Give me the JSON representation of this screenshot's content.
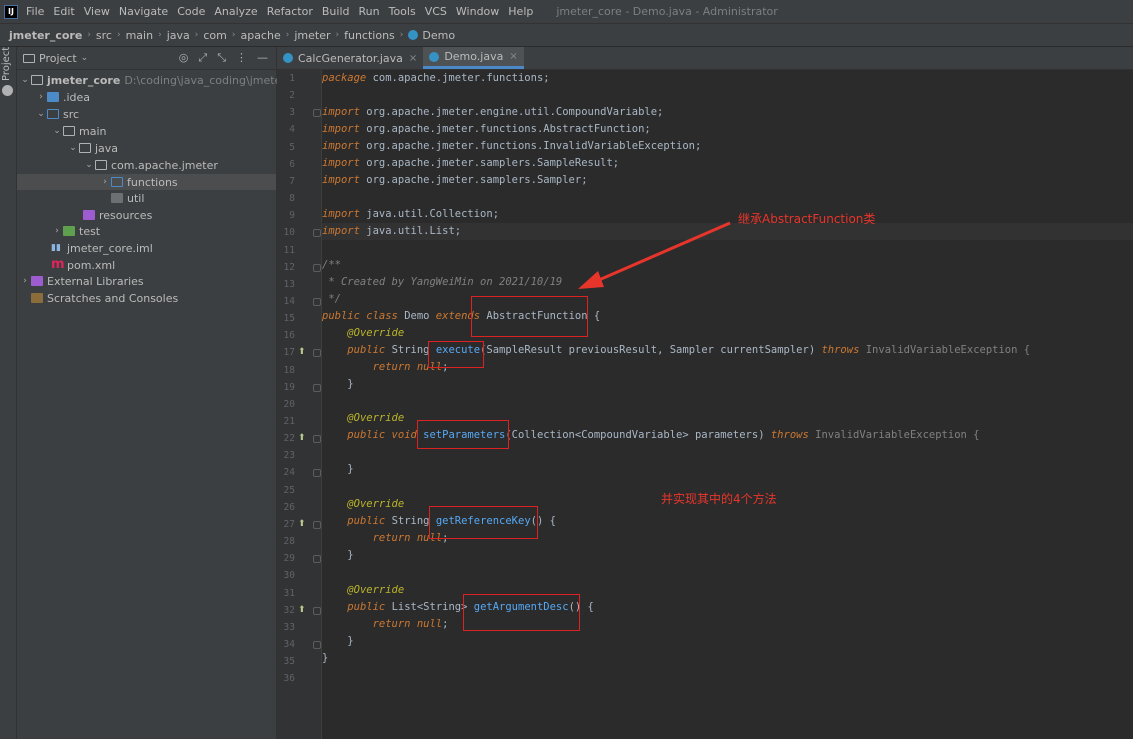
{
  "menu": {
    "items": [
      "File",
      "Edit",
      "View",
      "Navigate",
      "Code",
      "Analyze",
      "Refactor",
      "Build",
      "Run",
      "Tools",
      "VCS",
      "Window",
      "Help"
    ],
    "window_title": "jmeter_core - Demo.java - Administrator"
  },
  "breadcrumb": [
    "jmeter_core",
    "src",
    "main",
    "java",
    "com",
    "apache",
    "jmeter",
    "functions",
    "Demo"
  ],
  "project_panel": {
    "title": "Project",
    "stripe_label": "Project",
    "tree": [
      {
        "label": "jmeter_core",
        "path": "D:\\coding\\java_coding\\jmeter_core"
      },
      {
        "label": ".idea"
      },
      {
        "label": "src"
      },
      {
        "label": "main"
      },
      {
        "label": "java"
      },
      {
        "label": "com.apache.jmeter"
      },
      {
        "label": "functions"
      },
      {
        "label": "util"
      },
      {
        "label": "resources"
      },
      {
        "label": "test"
      },
      {
        "label": "jmeter_core.iml"
      },
      {
        "label": "pom.xml"
      },
      {
        "label": "External Libraries"
      },
      {
        "label": "Scratches and Consoles"
      }
    ]
  },
  "editor_tabs": [
    {
      "label": "CalcGenerator.java",
      "active": false
    },
    {
      "label": "Demo.java",
      "active": true
    }
  ],
  "line_numbers": [
    "1",
    "2",
    "3",
    "4",
    "5",
    "6",
    "7",
    "8",
    "9",
    "10",
    "11",
    "12",
    "13",
    "14",
    "15",
    "16",
    "17",
    "18",
    "19",
    "20",
    "21",
    "22",
    "23",
    "24",
    "25",
    "26",
    "27",
    "28",
    "29",
    "30",
    "31",
    "32",
    "33",
    "34",
    "35",
    "36"
  ],
  "code": {
    "package_stmt": "com.apache.jmeter.functions;",
    "imports": [
      "org.apache.jmeter.engine.util.CompoundVariable;",
      "org.apache.jmeter.functions.AbstractFunction;",
      "org.apache.jmeter.functions.InvalidVariableException;",
      "org.apache.jmeter.samplers.SampleResult;",
      "org.apache.jmeter.samplers.Sampler;",
      "java.util.Collection;",
      "java.util.List;"
    ],
    "comment_open": "/**",
    "comment_body": " * Created by YangWeiMin on 2021/10/19",
    "comment_close": " */",
    "class_name": "Demo",
    "super_class": "AbstractFunction",
    "override": "@Override",
    "m1_name": "execute",
    "m1_params": "(SampleResult previousResult, Sampler currentSampler) ",
    "m2_name": "setParameters",
    "m2_params": "(Collection<CompoundVariable> parameters) ",
    "m3_name": "getReferenceKey",
    "m4_name": "getArgumentDesc",
    "exception": "InvalidVariableException {",
    "ret_null": "null",
    "list_type": "List<String>"
  },
  "annotations": {
    "inherit_note": "继承AbstractFunction类",
    "implement_note": "并实现其中的4个方法"
  },
  "colors": {
    "annotation_red": "#e8352b",
    "keyword": "#cc7832",
    "method_decl": "#56a8f5"
  }
}
